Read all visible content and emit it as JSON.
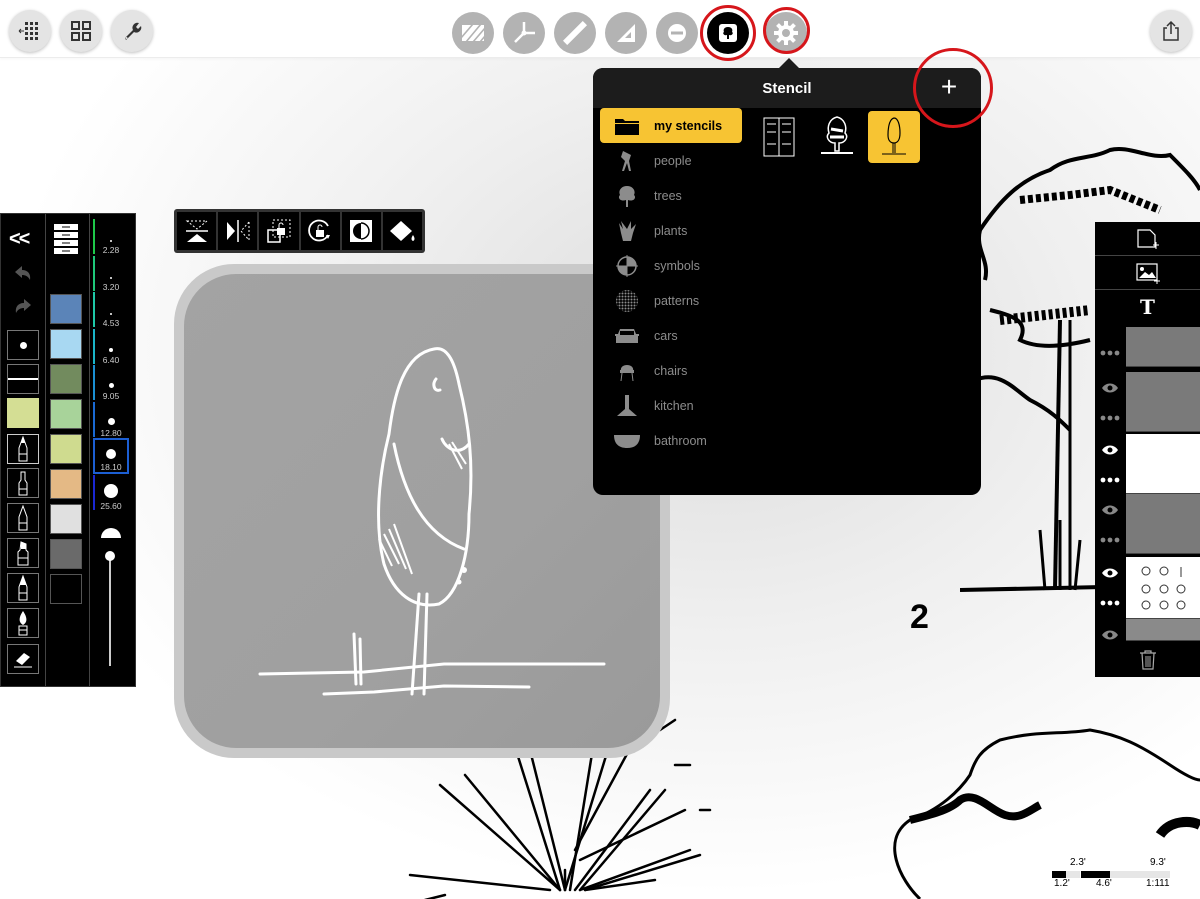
{
  "topbar": {
    "left_buttons": [
      {
        "name": "hide-grid",
        "icon": "grid-collapse-icon"
      },
      {
        "name": "gallery",
        "icon": "four-squares-icon"
      },
      {
        "name": "settings",
        "icon": "wrench-icon"
      }
    ],
    "center_buttons": [
      {
        "name": "hatch",
        "icon": "hatch-pattern-icon",
        "state": "inactive"
      },
      {
        "name": "perspective",
        "icon": "perspective-axes-icon",
        "state": "inactive"
      },
      {
        "name": "ruler",
        "icon": "ruler-icon",
        "state": "inactive"
      },
      {
        "name": "set-square",
        "icon": "triangle-ruler-icon",
        "state": "inactive"
      },
      {
        "name": "ellipse",
        "icon": "ellipse-guide-icon",
        "state": "inactive"
      },
      {
        "name": "stencil",
        "icon": "tree-stencil-icon",
        "state": "active",
        "highlighted": true
      },
      {
        "name": "gear",
        "icon": "gear-icon",
        "state": "inactive",
        "highlighted": true
      }
    ],
    "right_buttons": [
      {
        "name": "share",
        "icon": "share-icon"
      }
    ]
  },
  "stencil_popover": {
    "title": "Stencil",
    "add_label": "+",
    "add_highlighted": true,
    "categories": [
      {
        "label": "my stencils",
        "icon": "folder-icon",
        "active": true
      },
      {
        "label": "people",
        "icon": "person-icon",
        "active": false
      },
      {
        "label": "trees",
        "icon": "tree-icon",
        "active": false
      },
      {
        "label": "plants",
        "icon": "plant-icon",
        "active": false
      },
      {
        "label": "symbols",
        "icon": "symbol-quadrant-icon",
        "active": false
      },
      {
        "label": "patterns",
        "icon": "dot-pattern-icon",
        "active": false
      },
      {
        "label": "cars",
        "icon": "car-icon",
        "active": false
      },
      {
        "label": "chairs",
        "icon": "chair-icon",
        "active": false
      },
      {
        "label": "kitchen",
        "icon": "range-hood-icon",
        "active": false
      },
      {
        "label": "bathroom",
        "icon": "bathtub-icon",
        "active": false
      }
    ],
    "stencils": [
      {
        "name": "door-elevation",
        "active": false
      },
      {
        "name": "tree-sketch",
        "active": false
      },
      {
        "name": "cypress-tree",
        "active": true
      }
    ]
  },
  "left_panel": {
    "collapse_label": "<<",
    "tools": [
      {
        "name": "dot-brush",
        "icon": "dot-brush-icon"
      },
      {
        "name": "line-brush",
        "icon": "line-brush-icon"
      },
      {
        "name": "color-fill",
        "icon": "color-swatch-icon"
      },
      {
        "name": "fine-pen",
        "icon": "fine-pen-icon",
        "active": true
      },
      {
        "name": "fineliner",
        "icon": "fineliner-icon"
      },
      {
        "name": "pencil",
        "icon": "pencil-icon"
      },
      {
        "name": "marker",
        "icon": "marker-icon"
      },
      {
        "name": "felt-pen",
        "icon": "felt-pen-icon"
      },
      {
        "name": "brush",
        "icon": "brush-icon"
      },
      {
        "name": "eraser",
        "icon": "eraser-icon"
      }
    ],
    "colors": [
      "#5b84b8",
      "#a8d8f2",
      "#728b5e",
      "#a8d39a",
      "#cfdb8f",
      "#e4b985",
      "#e0e0e0",
      "#6a6a6a",
      "#000000"
    ],
    "active_color_tool": "#d4de94",
    "sizes": [
      "2.28",
      "3.20",
      "4.53",
      "6.40",
      "9.05",
      "12.80",
      "18.10",
      "25.60"
    ],
    "active_size": "18.10",
    "opacity": 1.0
  },
  "transform_bar": [
    {
      "name": "flip-vertical",
      "icon": "flip-vertical-icon"
    },
    {
      "name": "flip-horizontal",
      "icon": "flip-horizontal-icon"
    },
    {
      "name": "unlock-scale",
      "icon": "unlock-scale-icon"
    },
    {
      "name": "unlock-rotate",
      "icon": "unlock-rotate-icon"
    },
    {
      "name": "invert",
      "icon": "invert-contrast-icon"
    },
    {
      "name": "fill",
      "icon": "paint-bucket-icon"
    }
  ],
  "right_panel": {
    "actions": [
      {
        "name": "new-layer",
        "icon": "new-page-icon"
      },
      {
        "name": "image-layer",
        "icon": "image-layer-icon"
      },
      {
        "name": "text-layer",
        "icon": "text-icon",
        "label": "T"
      }
    ],
    "layers": [
      {
        "visible": false,
        "thumb": "#7a7a7a"
      },
      {
        "visible": false,
        "thumb": "#7a7a7a"
      },
      {
        "visible": true,
        "thumb": "#ffffff"
      },
      {
        "visible": false,
        "thumb": "#7a7a7a"
      },
      {
        "visible": true,
        "thumb": "#ffffff"
      },
      {
        "visible": false,
        "thumb": "#8a8a8a"
      }
    ],
    "delete_icon": "trash-icon"
  },
  "canvas": {
    "page_label": "2"
  },
  "scale_bar": {
    "top_labels": [
      "2.3'",
      "9.3'"
    ],
    "bottom_labels": [
      "1.2'",
      "4.6'"
    ],
    "ratio": "1:111"
  }
}
